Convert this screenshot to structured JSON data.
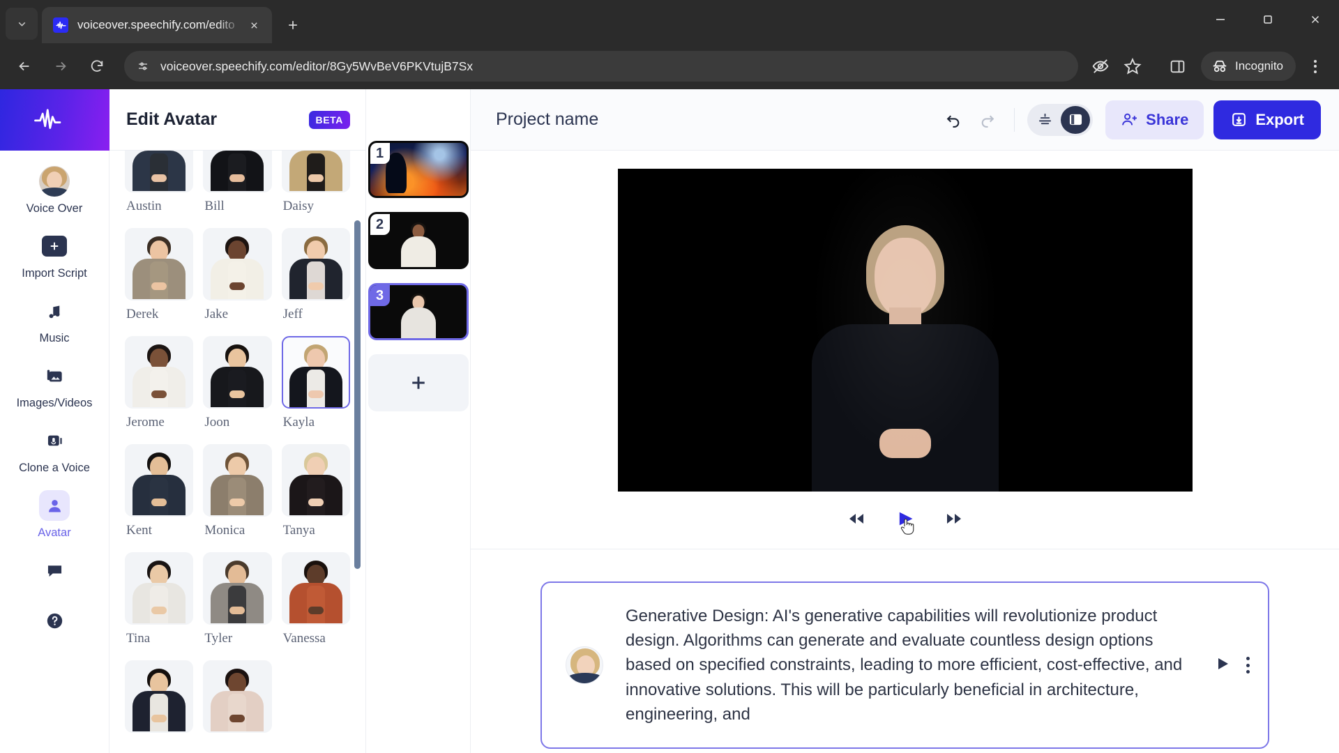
{
  "browser": {
    "tab": {
      "title": "voiceover.speechify.com/edito",
      "favicon": "speechify-icon"
    },
    "url": "voiceover.speechify.com/editor/8Gy5WvBeV6PKVtujB7Sx",
    "incognito_label": "Incognito",
    "icons": {
      "tab_list": "chevron-down-icon",
      "close_tab": "close-icon",
      "new_tab": "plus-icon",
      "back": "back-arrow-icon",
      "forward": "forward-arrow-icon",
      "reload": "reload-icon",
      "site_info": "site-settings-icon",
      "tracking": "eye-off-icon",
      "bookmark": "star-icon",
      "side_panel": "side-panel-icon",
      "incognito": "incognito-hat-icon",
      "menu": "three-dot-menu-icon",
      "minimize": "minimize-icon",
      "maximize": "maximize-icon",
      "window_close": "window-close-icon"
    }
  },
  "sidebar": {
    "brand": "speechify-logo",
    "items": [
      {
        "label": "Voice Over",
        "icon": "voice-over-avatar-icon",
        "active": false
      },
      {
        "label": "Import Script",
        "icon": "plus-square-icon",
        "active": false
      },
      {
        "label": "Music",
        "icon": "music-note-icon",
        "active": false
      },
      {
        "label": "Images/Videos",
        "icon": "images-videos-icon",
        "active": false
      },
      {
        "label": "Clone a Voice",
        "icon": "microphone-stack-icon",
        "active": false
      },
      {
        "label": "Avatar",
        "icon": "person-icon",
        "active": true
      },
      {
        "label": "",
        "icon": "chat-bubble-icon",
        "active": false
      },
      {
        "label": "",
        "icon": "help-question-icon",
        "active": false
      }
    ]
  },
  "library": {
    "title": "Edit Avatar",
    "badge": "BETA",
    "avatars": [
      {
        "name": "Austin",
        "selected": false,
        "skin": "#e9c3a4",
        "hair": "#3a2d24",
        "top": "#2c3647",
        "shirt": "#2a2f36"
      },
      {
        "name": "Bill",
        "selected": false,
        "skin": "#e6bd9c",
        "hair": "#2a2320",
        "top": "#121317",
        "shirt": "#1b1c20"
      },
      {
        "name": "Daisy",
        "selected": false,
        "skin": "#ecc8a8",
        "hair": "#2b211b",
        "top": "#c3a877",
        "shirt": "#1f1c1a"
      },
      {
        "name": "Derek",
        "selected": false,
        "skin": "#ecc4a2",
        "hair": "#3b2e24",
        "top": "#9c8f7c",
        "shirt": "#a59780"
      },
      {
        "name": "Jake",
        "selected": false,
        "skin": "#6b4430",
        "hair": "#1d1411",
        "top": "#f2efe6",
        "shirt": "#f4f1e8"
      },
      {
        "name": "Jeff",
        "selected": false,
        "skin": "#f0cbac",
        "hair": "#8a6b40",
        "top": "#20242e",
        "shirt": "#ded8d4"
      },
      {
        "name": "Jerome",
        "selected": false,
        "skin": "#7a5138",
        "hair": "#1c1513",
        "top": "#f0eee9",
        "shirt": "#f3f1ec"
      },
      {
        "name": "Joon",
        "selected": false,
        "skin": "#e9c49e",
        "hair": "#17120f",
        "top": "#17181c",
        "shirt": "#1a1b20"
      },
      {
        "name": "Kayla",
        "selected": true,
        "skin": "#eec8ae",
        "hair": "#c2a573",
        "top": "#14161d",
        "shirt": "#eceae6"
      },
      {
        "name": "Kent",
        "selected": false,
        "skin": "#e4be97",
        "hair": "#141110",
        "top": "#262f3e",
        "shirt": "#2a3342"
      },
      {
        "name": "Monica",
        "selected": false,
        "skin": "#edcaa9",
        "hair": "#6e5338",
        "top": "#8c7e6c",
        "shirt": "#9b8c78"
      },
      {
        "name": "Tanya",
        "selected": false,
        "skin": "#f0cfb4",
        "hair": "#d9c89a",
        "top": "#1b1618",
        "shirt": "#221c1e"
      },
      {
        "name": "Tina",
        "selected": false,
        "skin": "#eac9a6",
        "hair": "#191413",
        "top": "#e8e6e1",
        "shirt": "#efece7"
      },
      {
        "name": "Tyler",
        "selected": false,
        "skin": "#e3bb96",
        "hair": "#4a3a2c",
        "top": "#8f8a84",
        "shirt": "#3b3b3d"
      },
      {
        "name": "Vanessa",
        "selected": false,
        "skin": "#5d3c2a",
        "hair": "#1a110d",
        "top": "#b5502f",
        "shirt": "#c05a36"
      },
      {
        "name": "",
        "selected": false,
        "skin": "#e8c49e",
        "hair": "#140f0d",
        "top": "#1e2230",
        "shirt": "#e9e6e0"
      },
      {
        "name": "",
        "selected": false,
        "skin": "#6e4630",
        "hair": "#1b1210",
        "top": "#e3cfc4",
        "shirt": "#e8d7cc"
      }
    ]
  },
  "scenes": {
    "items": [
      {
        "number": "1",
        "selected": false,
        "kind": "artwork"
      },
      {
        "number": "2",
        "selected": false,
        "kind": "avatar-dark",
        "skin": "#8c5c40",
        "shirt": "#efece4"
      },
      {
        "number": "3",
        "selected": true,
        "kind": "avatar-dark",
        "skin": "#eac7ad",
        "shirt": "#e7e4df"
      }
    ],
    "add_label": "add-scene"
  },
  "header": {
    "project_name": "Project name",
    "undo_icon": "undo-icon",
    "redo_icon": "redo-icon",
    "settings_icon": "sliders-icon",
    "layout_icon": "layout-panel-icon",
    "share_label": "Share",
    "share_icon": "person-add-icon",
    "export_label": "Export",
    "export_icon": "download-box-icon",
    "accent": "#2f2ae0",
    "share_bg": "#e8e7fb"
  },
  "player": {
    "rewind_icon": "rewind-icon",
    "play_icon": "play-icon",
    "forward_icon": "fast-forward-icon",
    "cursor": "hand-pointer-cursor",
    "play_color": "#2f2ae0"
  },
  "script": {
    "avatar": "kayla-avatar-thumbnail",
    "text": "Generative Design: AI's generative capabilities will revolutionize product design. Algorithms can generate and evaluate countless design options based on specified constraints, leading to more efficient, cost-effective, and innovative solutions. This will be particularly beneficial in architecture, engineering, and",
    "play_icon": "play-icon",
    "menu_icon": "three-dot-menu-icon",
    "border_color": "#7d77e8"
  }
}
